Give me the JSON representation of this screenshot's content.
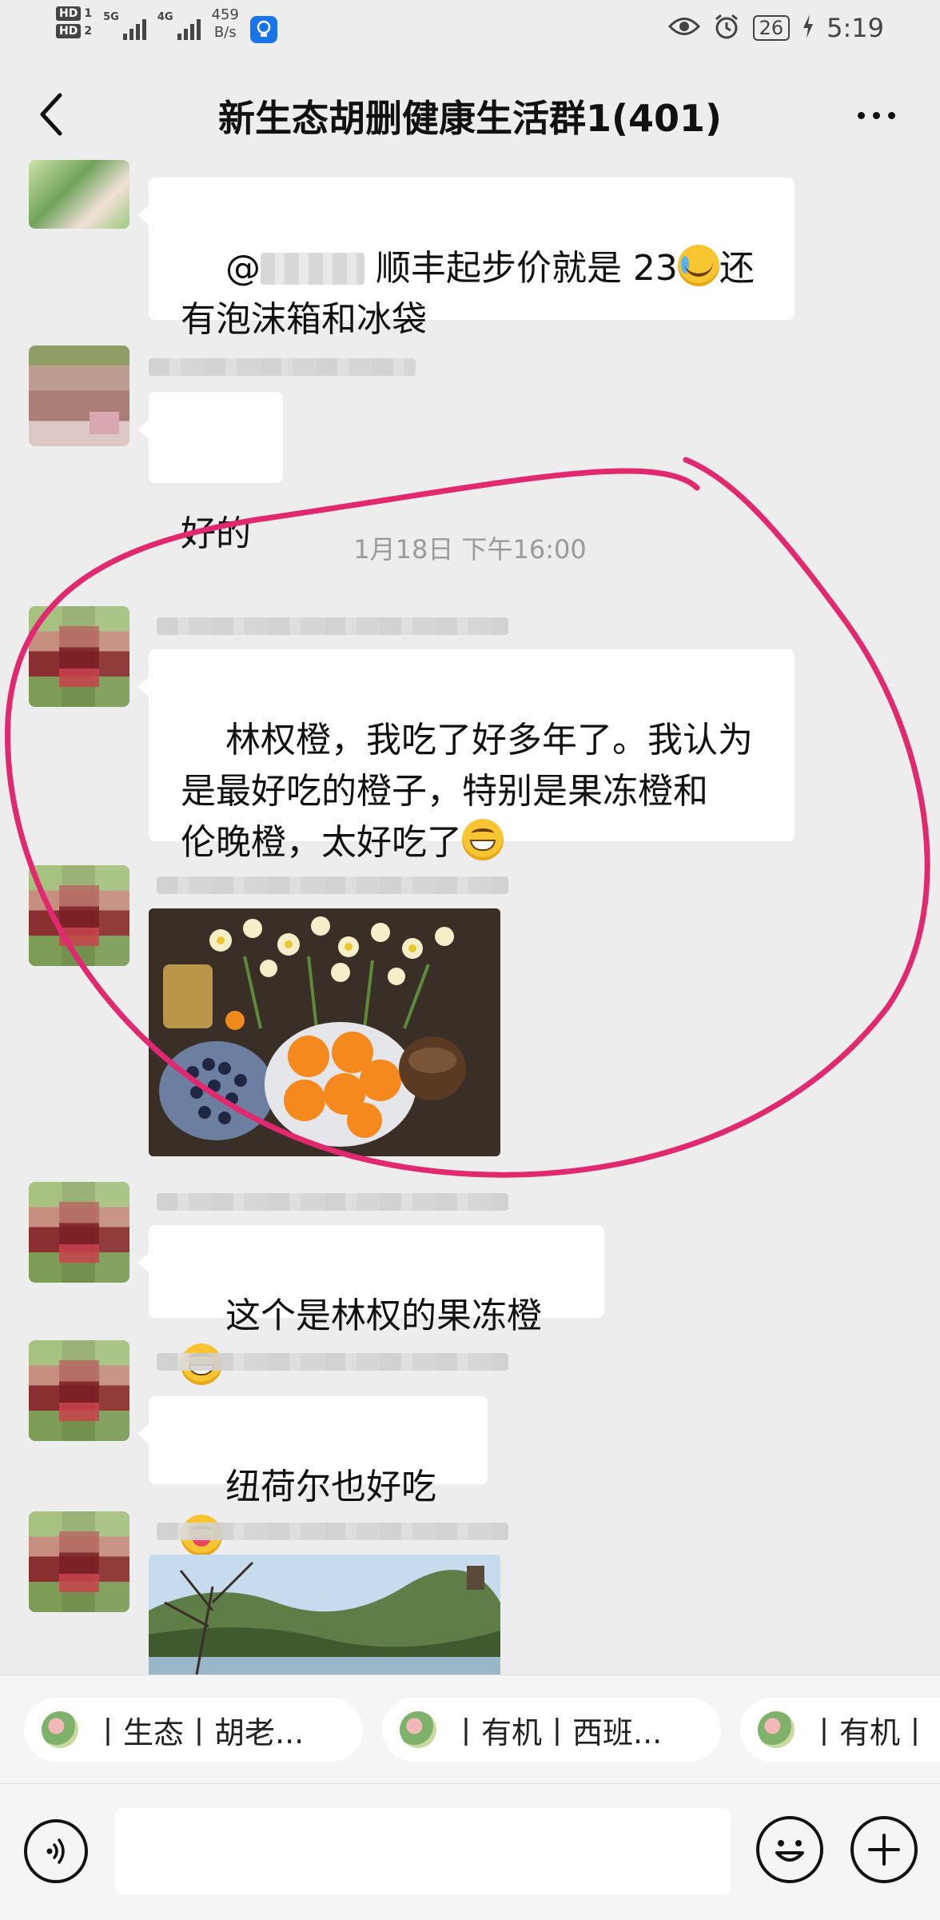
{
  "status_bar": {
    "hd1": "HD",
    "hd1_num": "1",
    "hd2": "HD",
    "hd2_num": "2",
    "net1": "5G",
    "net2": "4G",
    "speed_value": "459",
    "speed_unit": "B/s",
    "battery": "26",
    "time": "5:19"
  },
  "header": {
    "title": "新生态胡删健康生活群1(401)",
    "back_icon": "chevron-left-icon",
    "more_icon": "more-dots-icon"
  },
  "messages": {
    "m1_pre": "@",
    "m1_post": " 顺丰起步价就是 23",
    "m1_post2": "还\n有泡沫箱和冰袋",
    "m2": "好的",
    "timestamp": "1月18日 下午16:00",
    "m3": "林权橙，我吃了好多年了。我认为\n是最好吃的橙子，特别是果冻橙和\n伦晚橙，太好吃了",
    "m4": "这个是林权的果冻橙",
    "m5": "纽荷尔也好吃"
  },
  "annotation": {
    "color": "#e0296f"
  },
  "quick_replies": [
    {
      "label": "丨生态丨胡老..."
    },
    {
      "label": "丨有机丨西班..."
    },
    {
      "label": "丨有机丨"
    }
  ],
  "input": {
    "placeholder": "",
    "voice_icon": "voice-icon",
    "emoji_icon": "emoji-icon",
    "plus_icon": "plus-icon"
  }
}
